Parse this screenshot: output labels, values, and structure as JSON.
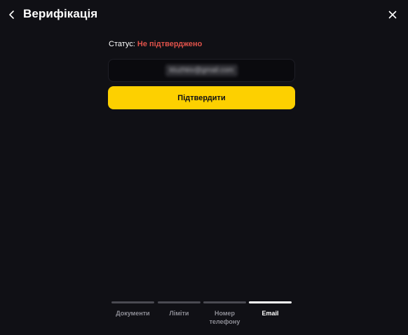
{
  "header": {
    "title": "Верифікація",
    "back_icon": "chevron-left-icon",
    "close_icon": "close-icon"
  },
  "status": {
    "label": "Статус:",
    "value": "Не підтверджено",
    "value_color": "#e0524a"
  },
  "email_field": {
    "value": "kluzhkiv@gmail.com",
    "masked": true
  },
  "confirm_button": {
    "label": "Підтвердити",
    "color": "#fdd000"
  },
  "tabs": [
    {
      "label": "Документи",
      "active": false
    },
    {
      "label": "Ліміти",
      "active": false
    },
    {
      "label": "Номер телефону",
      "active": false
    },
    {
      "label": "Email",
      "active": true
    }
  ]
}
